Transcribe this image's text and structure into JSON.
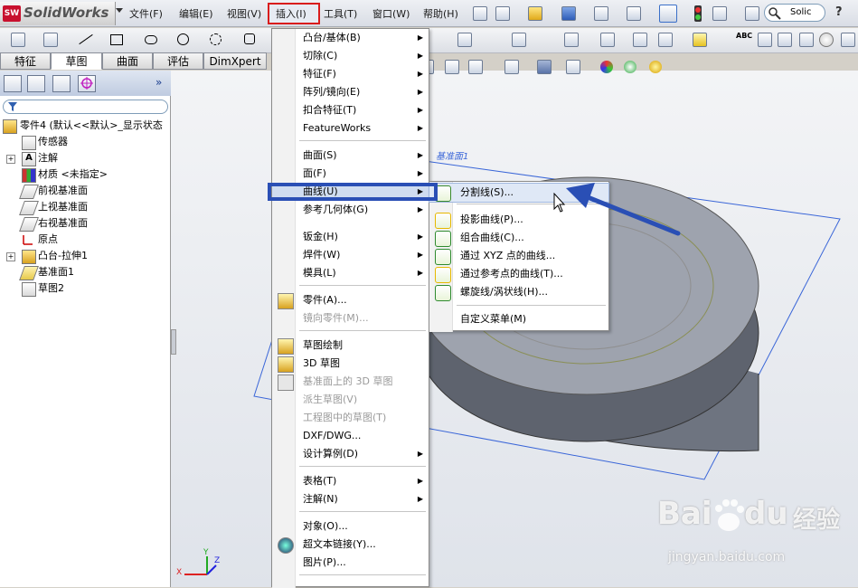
{
  "app": {
    "logo_text": "SolidWorks",
    "logo_badge": "SW"
  },
  "menubar": {
    "items": [
      "文件(F)",
      "编辑(E)",
      "视图(V)",
      "插入(I)",
      "工具(T)",
      "窗口(W)",
      "帮助(H)"
    ],
    "search_placeholder": "Solic",
    "help_label": "?"
  },
  "toolbar2": {
    "right_label": "ABC"
  },
  "tabs": [
    "特征",
    "草图",
    "曲面",
    "评估",
    "DimXpert"
  ],
  "tree": {
    "root": "零件4   (默认<<默认>_显示状态",
    "items": [
      "传感器",
      "注解",
      "材质 <未指定>",
      "前视基准面",
      "上视基准面",
      "右视基准面",
      "原点",
      "凸台-拉伸1",
      "基准面1",
      "草图2"
    ]
  },
  "insert_menu": {
    "items": [
      {
        "label": "凸台/基体(B)",
        "submenu": true
      },
      {
        "label": "切除(C)",
        "submenu": true
      },
      {
        "label": "特征(F)",
        "submenu": true
      },
      {
        "label": "阵列/镜向(E)",
        "submenu": true
      },
      {
        "label": "扣合特征(T)",
        "submenu": true
      },
      {
        "label": "FeatureWorks",
        "submenu": true
      },
      {
        "label": "曲面(S)",
        "submenu": true
      },
      {
        "label": "面(F)",
        "submenu": true
      },
      {
        "label": "曲线(U)",
        "submenu": true,
        "highlighted": true
      },
      {
        "label": "参考几何体(G)",
        "submenu": true
      },
      {
        "label": "钣金(H)",
        "submenu": true
      },
      {
        "label": "焊件(W)",
        "submenu": true
      },
      {
        "label": "模具(L)",
        "submenu": true
      },
      {
        "label": "零件(A)...",
        "icon": "part-icon"
      },
      {
        "label": "镜向零件(M)...",
        "disabled": true
      },
      {
        "label": "草图绘制",
        "icon": "sketch-icon"
      },
      {
        "label": "3D 草图",
        "icon": "3d-sketch-icon"
      },
      {
        "label": "基准面上的 3D 草图",
        "disabled": true,
        "icon": "plane-3d-sketch-icon"
      },
      {
        "label": "派生草图(V)",
        "disabled": true
      },
      {
        "label": "工程图中的草图(T)",
        "disabled": true
      },
      {
        "label": "DXF/DWG..."
      },
      {
        "label": "设计算例(D)",
        "submenu": true
      },
      {
        "label": "表格(T)",
        "submenu": true
      },
      {
        "label": "注解(N)",
        "submenu": true
      },
      {
        "label": "对象(O)..."
      },
      {
        "label": "超文本链接(Y)...",
        "icon": "hyperlink-icon"
      },
      {
        "label": "图片(P)..."
      }
    ]
  },
  "curve_submenu": {
    "items": [
      {
        "label": "分割线(S)...",
        "icon": "split-line-icon",
        "hovered": true
      },
      {
        "label": "投影曲线(P)...",
        "icon": "projected-curve-icon"
      },
      {
        "label": "组合曲线(C)...",
        "icon": "composite-curve-icon"
      },
      {
        "label": "通过 XYZ 点的曲线...",
        "icon": "xyz-curve-icon"
      },
      {
        "label": "通过参考点的曲线(T)...",
        "icon": "ref-point-curve-icon"
      },
      {
        "label": "螺旋线/涡状线(H)...",
        "icon": "helix-icon"
      },
      {
        "label": "自定义菜单(M)"
      }
    ]
  },
  "viewport": {
    "plane_label": "基准面1",
    "axis_x": "X",
    "axis_y": "Y",
    "axis_z": "Z"
  },
  "watermark": {
    "brand": "Bai",
    "brand2": "du",
    "cn": "经验",
    "url": "jingyan.baidu.com"
  },
  "colors": {
    "highlight_box": "#2a4fb5",
    "red_box": "#d91c1c",
    "arrow": "#2a4fb5"
  }
}
